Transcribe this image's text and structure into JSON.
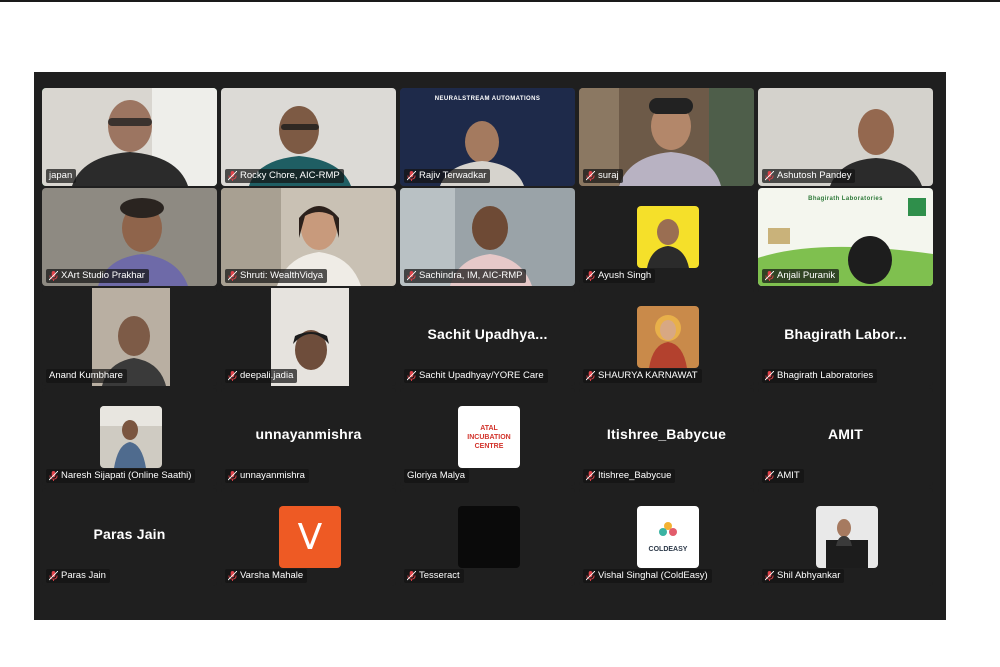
{
  "tiles": [
    {
      "name": "japan"
    },
    {
      "name": "Rocky Chore, AIC-RMP"
    },
    {
      "name": "Rajiv Terwadkar",
      "banner": "NEURALSTREAM AUTOMATIONS"
    },
    {
      "name": "suraj"
    },
    {
      "name": "Ashutosh Pandey"
    },
    {
      "name": "XArt Studio Prakhar"
    },
    {
      "name": "Shruti: WealthVidya"
    },
    {
      "name": "Sachindra, IM, AIC-RMP"
    },
    {
      "name": "Ayush Singh"
    },
    {
      "name": "Anjali Puranik",
      "banner": "Bhagirath Laboratories"
    },
    {
      "name": "Anand Kumbhare"
    },
    {
      "name": "deepali.jadia"
    },
    {
      "name": "Sachit Upadhyay/YORE Care",
      "display": "Sachit Upadhya..."
    },
    {
      "name": "SHAURYA KARNAWAT"
    },
    {
      "name": "Bhagirath Laboratories",
      "display": "Bhagirath Labor..."
    },
    {
      "name": "Naresh Sijapati (Online Saathi)"
    },
    {
      "name": "unnayanmishra",
      "display": "unnayanmishra"
    },
    {
      "name": "Gloriya Malya",
      "avatar_text": "ATAL INCUBATION CENTRE"
    },
    {
      "name": "Itishree_Babycue",
      "display": "Itishree_Babycue"
    },
    {
      "name": "AMIT",
      "display": "AMIT"
    },
    {
      "name": "Paras Jain",
      "display": "Paras Jain"
    },
    {
      "name": "Varsha Mahale",
      "avatar_letter": "V"
    },
    {
      "name": "Tesseract"
    },
    {
      "name": "Vishal Singhal (ColdEasy)",
      "avatar_text": "COLDEASY"
    },
    {
      "name": "Shil Abhyankar"
    }
  ],
  "colors": {
    "active_speaker": "#2fc86b",
    "mic_off": "#e0424a",
    "varsha_avatar": "#ee5a24",
    "ayush_avatar": "#f5e02a"
  }
}
